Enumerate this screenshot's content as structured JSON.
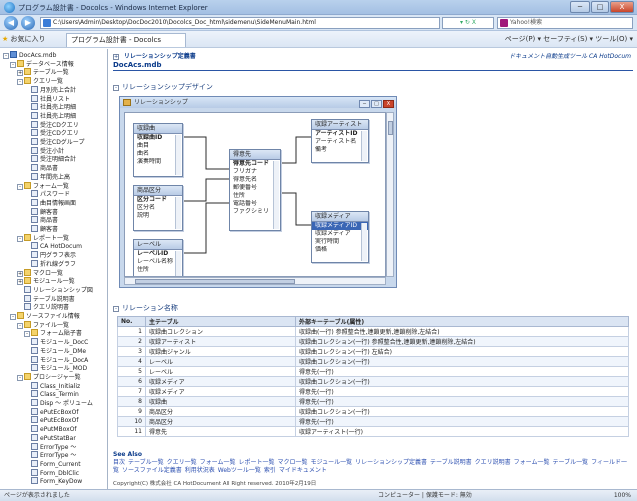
{
  "window": {
    "title": "プログラム設計書 - Docolcs - Windows Internet Explorer",
    "minimize": "─",
    "maximize": "□",
    "close": "X"
  },
  "addressbar": {
    "back": "◀",
    "forward": "▶",
    "url": "C:\\Users\\Admin\\Desktop\\DocDoc2010\\Docolcs_Doc_html\\sidemenu\\SideMenuMain.html",
    "controls": "▾ ↻ X",
    "search_placeholder": "Yahoo!検索"
  },
  "favbar": {
    "favorites": "お気に入り",
    "tab_label": "プログラム設計書 - Docolcs",
    "tools": "ページ(P) ▾  セーフティ(S) ▾  ツール(O) ▾"
  },
  "tree": {
    "items": [
      {
        "label": "DocAcs.mdb",
        "indent": 0,
        "kind": "blue",
        "pm": "-"
      },
      {
        "label": "データベース情報",
        "indent": 1,
        "kind": "folder",
        "pm": "-"
      },
      {
        "label": "テーブル一覧",
        "indent": 2,
        "kind": "folder",
        "pm": "+"
      },
      {
        "label": "クエリ一覧",
        "indent": 2,
        "kind": "folder",
        "pm": "-"
      },
      {
        "label": "月別売上合計",
        "indent": 4,
        "kind": "doc"
      },
      {
        "label": "社員リスト",
        "indent": 4,
        "kind": "doc"
      },
      {
        "label": "社員売上明細",
        "indent": 4,
        "kind": "doc"
      },
      {
        "label": "社員売上明細",
        "indent": 4,
        "kind": "doc"
      },
      {
        "label": "受注CDクエリ",
        "indent": 4,
        "kind": "doc"
      },
      {
        "label": "受注CDクエリ",
        "indent": 4,
        "kind": "doc"
      },
      {
        "label": "受注CDグループ",
        "indent": 4,
        "kind": "doc"
      },
      {
        "label": "受注小計",
        "indent": 4,
        "kind": "doc"
      },
      {
        "label": "受注明細合計",
        "indent": 4,
        "kind": "doc"
      },
      {
        "label": "商品書",
        "indent": 4,
        "kind": "doc"
      },
      {
        "label": "年間売上高",
        "indent": 4,
        "kind": "doc"
      },
      {
        "label": "フォーム一覧",
        "indent": 2,
        "kind": "folder",
        "pm": "-"
      },
      {
        "label": "パスワード",
        "indent": 4,
        "kind": "doc"
      },
      {
        "label": "曲目情報画面",
        "indent": 4,
        "kind": "doc"
      },
      {
        "label": "顧客書",
        "indent": 4,
        "kind": "doc"
      },
      {
        "label": "商品書",
        "indent": 4,
        "kind": "doc"
      },
      {
        "label": "顧客書",
        "indent": 4,
        "kind": "doc"
      },
      {
        "label": "レポート一覧",
        "indent": 2,
        "kind": "folder",
        "pm": "-"
      },
      {
        "label": "CA HotDocum",
        "indent": 4,
        "kind": "doc"
      },
      {
        "label": "円グラフ表示",
        "indent": 4,
        "kind": "doc"
      },
      {
        "label": "折れ線グラフ",
        "indent": 4,
        "kind": "doc"
      },
      {
        "label": "マクロ一覧",
        "indent": 2,
        "kind": "folder",
        "pm": "+"
      },
      {
        "label": "モジュール一覧",
        "indent": 2,
        "kind": "folder",
        "pm": "+"
      },
      {
        "label": "リレーションシップ図",
        "indent": 3,
        "kind": "doc"
      },
      {
        "label": "テーブル説明書",
        "indent": 3,
        "kind": "doc"
      },
      {
        "label": "クエリ説明書",
        "indent": 3,
        "kind": "doc"
      },
      {
        "label": "ソースファイル情報",
        "indent": 1,
        "kind": "folder",
        "pm": "-"
      },
      {
        "label": "ファイル一覧",
        "indent": 2,
        "kind": "folder",
        "pm": "-"
      },
      {
        "label": "フォーム貼子書",
        "indent": 3,
        "kind": "folder",
        "pm": "-"
      },
      {
        "label": "モジュール_DocC",
        "indent": 4,
        "kind": "doc"
      },
      {
        "label": "モジュール_DMe",
        "indent": 4,
        "kind": "doc"
      },
      {
        "label": "モジュール_DocA",
        "indent": 4,
        "kind": "doc"
      },
      {
        "label": "モジュール_MOD",
        "indent": 4,
        "kind": "doc"
      },
      {
        "label": "プロシージャ一覧",
        "indent": 2,
        "kind": "folder",
        "pm": "-"
      },
      {
        "label": "Class_Initializ",
        "indent": 4,
        "kind": "doc"
      },
      {
        "label": "Class_Termin",
        "indent": 4,
        "kind": "doc"
      },
      {
        "label": "Disp ～ ポリューム",
        "indent": 4,
        "kind": "doc"
      },
      {
        "label": "ePutEcBoxOf",
        "indent": 4,
        "kind": "doc"
      },
      {
        "label": "ePutEcBoxOf",
        "indent": 4,
        "kind": "doc"
      },
      {
        "label": "ePutMBoxOf",
        "indent": 4,
        "kind": "doc"
      },
      {
        "label": "ePutStatBar",
        "indent": 4,
        "kind": "doc"
      },
      {
        "label": "ErrorType ～",
        "indent": 4,
        "kind": "doc"
      },
      {
        "label": "ErrorType ～",
        "indent": 4,
        "kind": "doc"
      },
      {
        "label": "Form_Current",
        "indent": 4,
        "kind": "doc"
      },
      {
        "label": "Form_DblClic",
        "indent": 4,
        "kind": "doc"
      },
      {
        "label": "Form_KeyDow",
        "indent": 4,
        "kind": "doc"
      }
    ]
  },
  "main": {
    "breadcrumb_toggle": "+",
    "breadcrumb": "リレーションシップ定義書",
    "top_right_link": "ドキュメント自動生成ツール CA HotDocum",
    "file_name": "DocAcs.mdb",
    "section1_toggle": "-",
    "section1": "リレーションシップデザイン",
    "section2_toggle": "-",
    "section2": "リレーション名称"
  },
  "relwin": {
    "title": "リレーションシップ",
    "btn_min": "─",
    "btn_max": "□",
    "btn_close": "X",
    "tables": [
      {
        "title": "収録曲",
        "fields": [
          "収録曲ID",
          "曲目",
          "曲名",
          "演奏時間"
        ],
        "key": [
          0
        ]
      },
      {
        "title": "商品区分",
        "fields": [
          "区分コード",
          "区分名",
          "説明"
        ],
        "key": [
          0
        ]
      },
      {
        "title": "レーベル",
        "fields": [
          "レーベルID",
          "レーベル名称",
          "住所"
        ],
        "key": [
          0
        ]
      },
      {
        "title": "得意先",
        "fields": [
          "得意先コード",
          "フリガナ",
          "得意先名",
          "郵便番号",
          "住所",
          "電話番号",
          "ファクシミリ"
        ],
        "key": [
          0
        ]
      },
      {
        "title": "収録アーティスト",
        "fields": [
          "アーティストID",
          "アーティスト名",
          "備考"
        ],
        "key": [
          0
        ]
      },
      {
        "title": "収録メディア",
        "fields": [
          "収録メディアID",
          "収録メディア",
          "実行時間",
          "価格"
        ],
        "key": [],
        "sel": 0
      }
    ]
  },
  "relations": {
    "headers": [
      "No.",
      "主テーブル",
      "外部キーテーブル(属性)"
    ],
    "rows": [
      [
        "1",
        "収録曲コレクション",
        "収録曲(一行) 参照整合性,連鎖更新,連鎖削除,左結合)"
      ],
      [
        "2",
        "収録アーティスト",
        "収録曲コレクション(一行) 参照整合性,連鎖更新,連鎖削除,左結合)"
      ],
      [
        "3",
        "収録曲ジャンル",
        "収録曲コレクション(一行) 左結合)"
      ],
      [
        "4",
        "レーベル",
        "収録曲コレクション(一行)"
      ],
      [
        "5",
        "レーベル",
        "得意先(一行)"
      ],
      [
        "6",
        "収録メディア",
        "収録曲コレクション(一行)"
      ],
      [
        "7",
        "収録メディア",
        "得意先(一行)"
      ],
      [
        "8",
        "収録曲",
        "得意先(一行)"
      ],
      [
        "9",
        "商品区分",
        "収録曲コレクション(一行)"
      ],
      [
        "10",
        "商品区分",
        "得意先(一行)"
      ],
      [
        "11",
        "得意先",
        "収録アーティスト(一行)"
      ]
    ]
  },
  "footer": {
    "see_also": "See Also",
    "links": [
      "目次",
      "テーブル一覧",
      "クエリ一覧",
      "フォーム一覧",
      "レポート一覧",
      "マクロ一覧",
      "モジュール一覧",
      "リレーションシップ定義書",
      "テーブル説明書",
      "クエリ説明書",
      "フォーム一覧",
      "テーブル一覧",
      "フィールド一覧",
      "ソースファイル定義書",
      "利用状況表",
      "Webツール一覧",
      "索引",
      "マイドキュメント"
    ],
    "copyright": "Copyright(C) 株式会社 CA HotDocument  All Right reserved. 2010年2月19日"
  },
  "status": {
    "left": "ページが表示されました",
    "right": "コンピューター | 保護モード: 無効",
    "zoom": "100%"
  }
}
